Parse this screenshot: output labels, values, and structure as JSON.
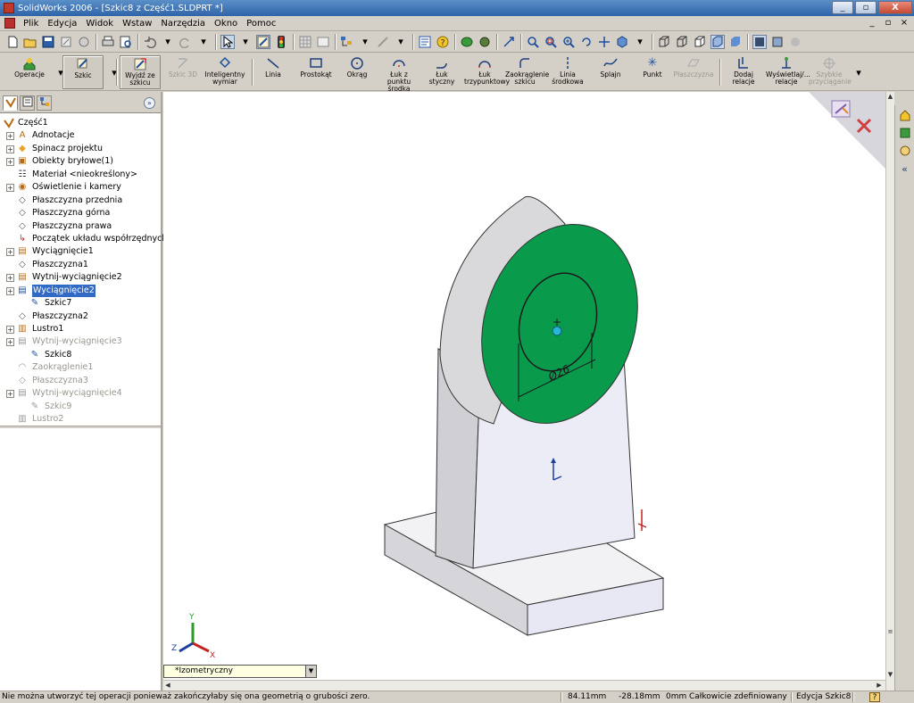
{
  "window": {
    "title": "SolidWorks 2006 - [Szkic8 z Część1.SLDPRT *]",
    "minimize": "_",
    "restore": "▫",
    "close": "X",
    "mdi_minimize": "_",
    "mdi_restore": "▫",
    "mdi_close": "×"
  },
  "menu": [
    "Plik",
    "Edycja",
    "Widok",
    "Wstaw",
    "Narzędzia",
    "Okno",
    "Pomoc"
  ],
  "commands": {
    "operacje": "Operacje",
    "szkic": "Szkic",
    "wyjdz_line1": "Wyjdź ze",
    "wyjdz_line2": "szkicu",
    "szkic3d": "Szkic 3D",
    "intel_line1": "Inteligentny",
    "intel_line2": "wymiar",
    "linia": "Linia",
    "prostokat": "Prostokąt",
    "okrag": "Okrąg",
    "luk_pkt_line1": "Łuk z punktu",
    "luk_pkt_line2": "środka",
    "luk_styczny": "Łuk styczny",
    "luk_3_line1": "Łuk",
    "luk_3_line2": "trzypunktowy",
    "zaokr_line1": "Zaokrąglenie",
    "zaokr_line2": "szkicu",
    "lsr_line1": "Linia",
    "lsr_line2": "środkowa",
    "splajn": "Splajn",
    "punkt": "Punkt",
    "plaszczyzna": "Płaszczyzna",
    "dodaj_relacje": "Dodaj relacje",
    "wysw_line1": "Wyświetlaj/...",
    "wysw_line2": "relacje",
    "szybkie_line1": "Szybkie",
    "szybkie_line2": "przyciąganie"
  },
  "tree": {
    "root": "Część1",
    "items": [
      {
        "label": "Adnotacje",
        "state": "normal"
      },
      {
        "label": "Spinacz projektu",
        "state": "normal"
      },
      {
        "label": "Obiekty bryłowe(1)",
        "state": "normal"
      },
      {
        "label": "Materiał <nieokreślony>",
        "state": "normal"
      },
      {
        "label": "Oświetlenie i kamery",
        "state": "normal"
      },
      {
        "label": "Płaszczyzna przednia",
        "state": "normal"
      },
      {
        "label": "Płaszczyzna górna",
        "state": "normal"
      },
      {
        "label": "Płaszczyzna prawa",
        "state": "normal"
      },
      {
        "label": "Początek układu współrzędnych",
        "state": "normal"
      },
      {
        "label": "Wyciągnięcie1",
        "state": "normal"
      },
      {
        "label": "Płaszczyzna1",
        "state": "normal"
      },
      {
        "label": "Wytnij-wyciągnięcie2",
        "state": "normal"
      },
      {
        "label": "Wyciągnięcie2",
        "state": "selected"
      },
      {
        "label": "Szkic7",
        "state": "normal"
      },
      {
        "label": "Płaszczyzna2",
        "state": "normal"
      },
      {
        "label": "Lustro1",
        "state": "normal"
      },
      {
        "label": "Wytnij-wyciągnięcie3",
        "state": "dim"
      },
      {
        "label": "Szkic8",
        "state": "normal"
      },
      {
        "label": "Zaokrąglenie1",
        "state": "dim"
      },
      {
        "label": "Płaszczyzna3",
        "state": "dim"
      },
      {
        "label": "Wytnij-wyciągnięcie4",
        "state": "dim"
      },
      {
        "label": "Szkic9",
        "state": "dim"
      },
      {
        "label": "Lustro2",
        "state": "dim"
      }
    ]
  },
  "viewport": {
    "dimension_label": "Ø26",
    "view_orientation": "*Izometryczny",
    "face_color": "#0a9a4c",
    "accent_selection": "#316ac5"
  },
  "status": {
    "message": "Nie można utworzyć tej operacji ponieważ zakończyłaby się ona geometrią o grubości zero.",
    "x": "84.11mm",
    "y": "-28.18mm",
    "z": "0mm",
    "definition": "Całkowicie zdefiniowany",
    "mode": "Edycja Szkic8",
    "help": "?"
  },
  "triad": {
    "x": "X",
    "y": "Y",
    "z": "Z"
  }
}
